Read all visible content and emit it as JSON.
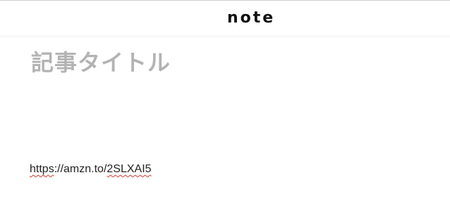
{
  "header": {
    "logo_text": "note"
  },
  "editor": {
    "title_placeholder": "記事タイトル",
    "body": {
      "part1": "https",
      "part2": "://amzn.to/",
      "part3": "2SLXAI5"
    }
  },
  "colors": {
    "placeholder": "#b3b3b3",
    "spellcheck_underline": "#d23a3a"
  }
}
